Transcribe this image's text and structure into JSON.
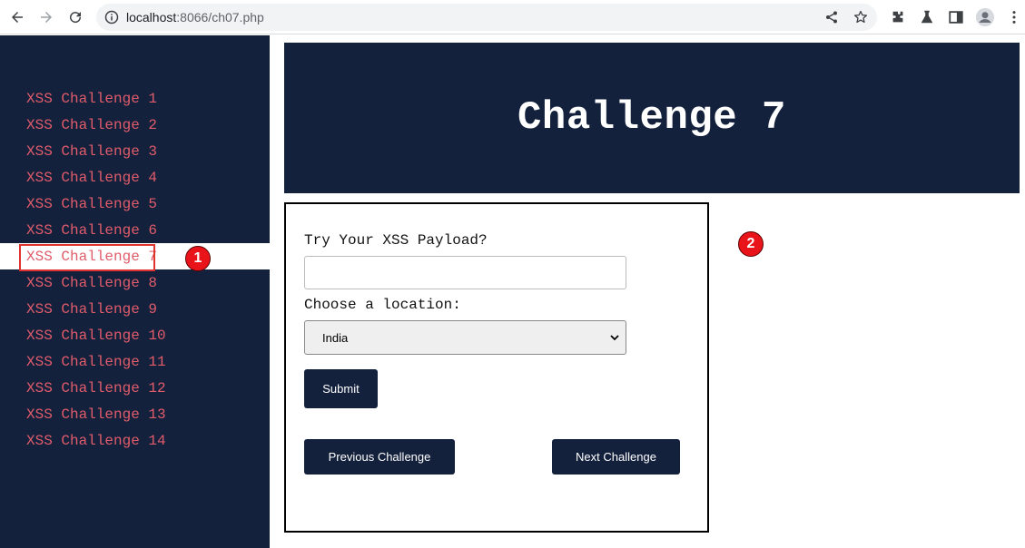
{
  "browser": {
    "url_host": "localhost",
    "url_rest": ":8066/ch07.php"
  },
  "sidebar": {
    "items": [
      {
        "label": "XSS Challenge 1"
      },
      {
        "label": "XSS Challenge 2"
      },
      {
        "label": "XSS Challenge 3"
      },
      {
        "label": "XSS Challenge 4"
      },
      {
        "label": "XSS Challenge 5"
      },
      {
        "label": "XSS Challenge 6"
      },
      {
        "label": "XSS Challenge 7"
      },
      {
        "label": "XSS Challenge 8"
      },
      {
        "label": "XSS Challenge 9"
      },
      {
        "label": "XSS Challenge 10"
      },
      {
        "label": "XSS Challenge 11"
      },
      {
        "label": "XSS Challenge 12"
      },
      {
        "label": "XSS Challenge 13"
      },
      {
        "label": "XSS Challenge 14"
      }
    ],
    "active_index": 6
  },
  "markers": {
    "one": "1",
    "two": "2"
  },
  "header": {
    "title": "Challenge 7"
  },
  "form": {
    "payload_label": "Try Your XSS Payload?",
    "payload_value": "",
    "location_label": "Choose a location:",
    "location_selected": "India",
    "submit_label": "Submit",
    "prev_label": "Previous Challenge",
    "next_label": "Next Challenge"
  },
  "colors": {
    "navy": "#14213d",
    "link": "#e05c6a",
    "marker": "#e8141a"
  }
}
